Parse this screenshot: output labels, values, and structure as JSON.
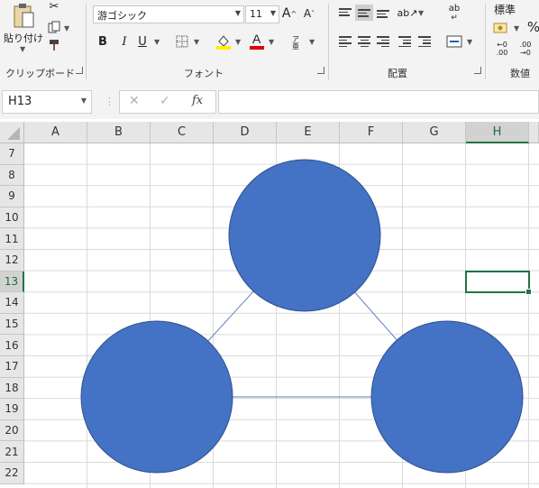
{
  "ribbon": {
    "clipboard": {
      "paste_label": "貼り付け",
      "group_label": "クリップボード"
    },
    "font": {
      "font_name": "游ゴシック",
      "font_size": "11",
      "bold": "B",
      "italic": "I",
      "underline": "U",
      "group_label": "フォント",
      "phonetic_glyph": "ア亜"
    },
    "alignment": {
      "group_label": "配置",
      "wrap_glyph": "ab"
    },
    "number": {
      "format": "標準",
      "percent": "%",
      "group_label": "数値",
      "inc_decimal": "←0 .00",
      "dec_decimal": ".00 →0"
    }
  },
  "formula_bar": {
    "name_box": "H13",
    "fx": "fx",
    "cancel": "✕",
    "enter": "✓",
    "formula": ""
  },
  "sheet": {
    "columns": [
      "A",
      "B",
      "C",
      "D",
      "E",
      "F",
      "G",
      "H"
    ],
    "rows": [
      "7",
      "8",
      "9",
      "10",
      "11",
      "12",
      "13",
      "14",
      "15",
      "16",
      "17",
      "18",
      "19",
      "20",
      "21",
      "22"
    ],
    "selected_cell": "H13"
  },
  "shapes": {
    "fill": "#4472c4",
    "stroke": "#2f528f",
    "connector": "#5b7fbf",
    "circles": [
      {
        "name": "top-circle",
        "anchor": "E10"
      },
      {
        "name": "bottom-left-circle",
        "anchor": "B17"
      },
      {
        "name": "bottom-right-circle",
        "anchor": "G17"
      }
    ]
  },
  "colors": {
    "ribbon_bg": "#f3f3f3",
    "header_bg": "#e6e6e6",
    "select_green": "#217346",
    "font_red": "#e00000",
    "highlight_yellow": "#ffee00"
  }
}
